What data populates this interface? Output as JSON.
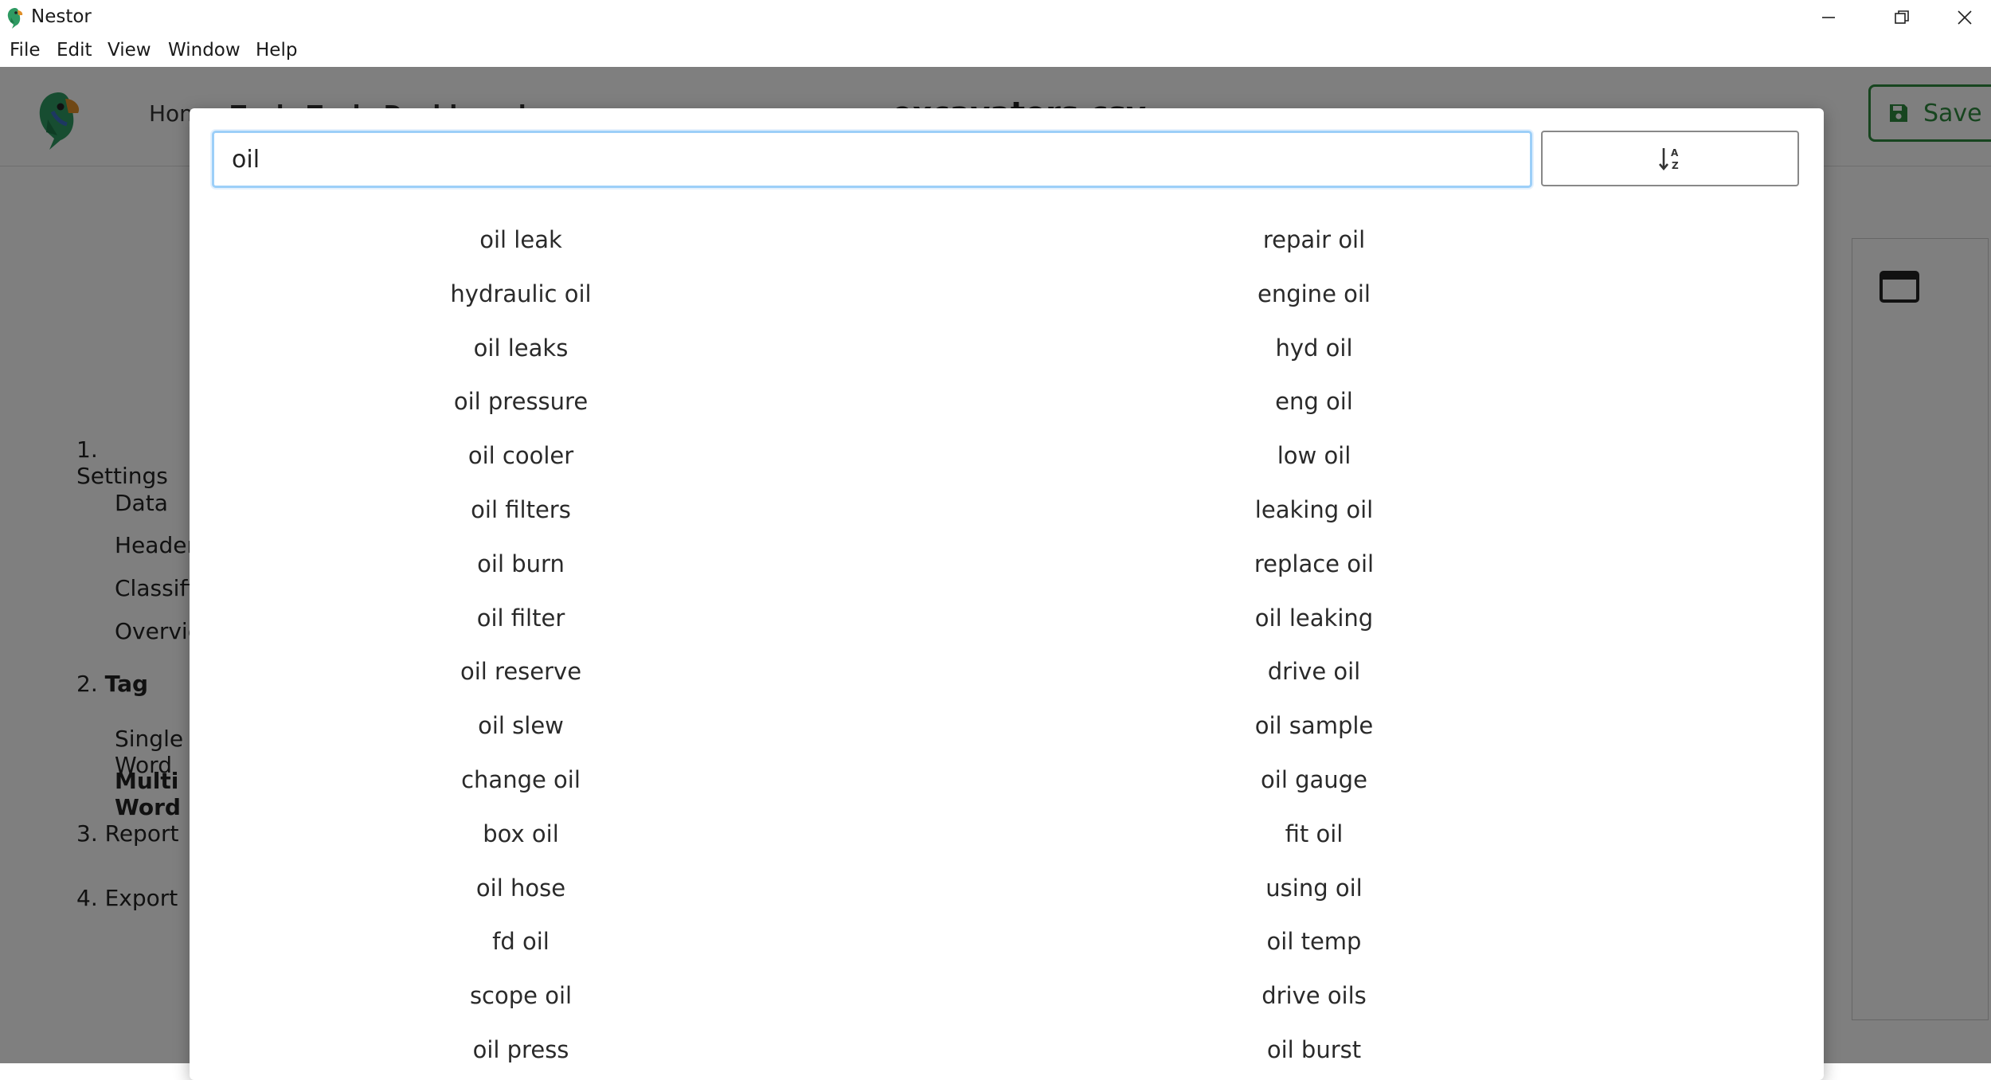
{
  "window": {
    "title": "Nestor",
    "controls": [
      "minimize-icon",
      "restore-icon",
      "close-icon"
    ]
  },
  "menubar": {
    "items": [
      "File",
      "Edit",
      "View",
      "Window",
      "Help"
    ]
  },
  "app": {
    "nav_home": "Home",
    "nav_more": "Tools Tools Dashboard",
    "filename": "excavators.csv",
    "save_label": "Save",
    "sidebar": {
      "step1": "1. Settings",
      "step1_items": [
        "Data",
        "Header",
        "Classification",
        "Overview"
      ],
      "step2_prefix": "2.",
      "step2": "Tag",
      "step2_items": [
        "Single Word",
        "Multi Word"
      ],
      "step3": "3. Report",
      "step4": "4. Export"
    }
  },
  "modal": {
    "search": {
      "value": "oil",
      "placeholder": ""
    },
    "sort_icon": "sort-alpha-down-icon",
    "terms_left": [
      "oil leak",
      "hydraulic oil",
      "oil leaks",
      "oil pressure",
      "oil cooler",
      "oil filters",
      "oil burn",
      "oil filter",
      "oil reserve",
      "oil slew",
      "change oil",
      "box oil",
      "oil hose",
      "fd oil",
      "scope oil",
      "oil press"
    ],
    "terms_right": [
      "repair oil",
      "engine oil",
      "hyd oil",
      "eng oil",
      "low oil",
      "leaking oil",
      "replace oil",
      "oil leaking",
      "drive oil",
      "oil sample",
      "oil gauge",
      "fit oil",
      "using oil",
      "oil temp",
      "drive oils",
      "oil burst"
    ]
  },
  "colors": {
    "accent_green": "#2e8b3e",
    "focus_blue": "#9ccff8",
    "backdrop": "rgba(0,0,0,0.5)"
  }
}
